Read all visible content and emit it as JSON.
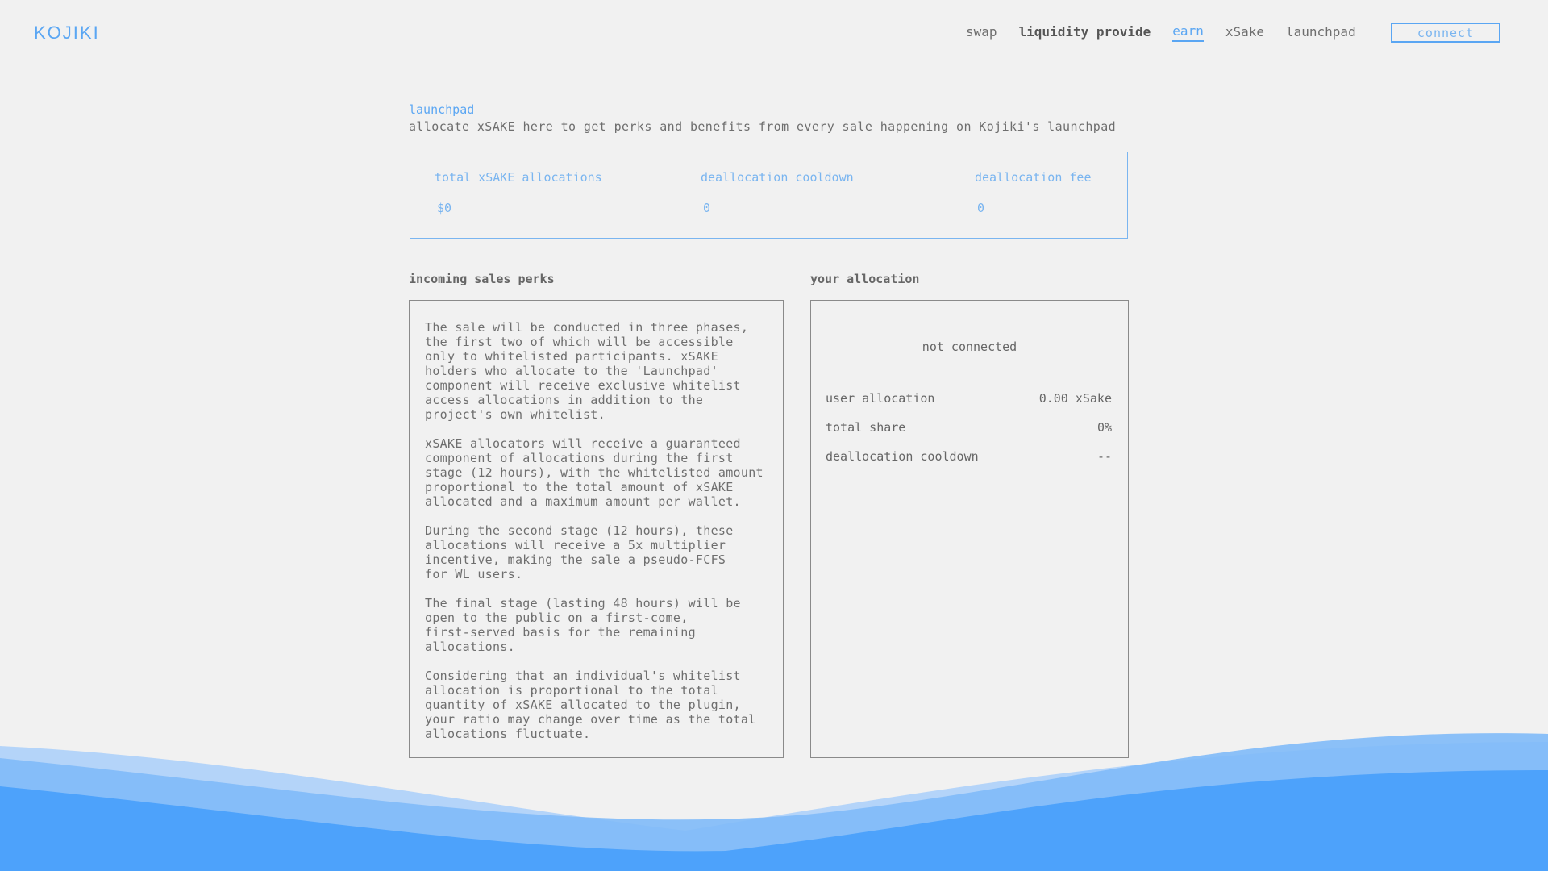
{
  "brand": {
    "logo": "KOJIKI"
  },
  "nav": {
    "items": [
      "swap",
      "liquidity provide",
      "earn",
      "xSake",
      "launchpad"
    ],
    "connect_label": "connect"
  },
  "intro": {
    "tag": "launchpad",
    "description": "allocate xSAKE here to get perks and benefits from every sale happening on Kojiki's launchpad"
  },
  "stats": [
    {
      "label": "total xSAKE allocations",
      "value": "$0"
    },
    {
      "label": "deallocation cooldown",
      "value": "0"
    },
    {
      "label": "deallocation fee",
      "value": "0"
    }
  ],
  "perks": {
    "title": "incoming sales perks",
    "paragraphs": [
      "The sale will be conducted in three phases,\nthe first two of which will be accessible\nonly to whitelisted participants. xSAKE\nholders who allocate to the 'Launchpad'\ncomponent will receive exclusive whitelist\naccess allocations in addition to the\nproject's own whitelist.",
      "xSAKE allocators will receive a guaranteed\ncomponent of allocations during the first\nstage (12 hours), with the whitelisted amount\nproportional to the total amount of xSAKE\nallocated and a maximum amount per wallet.",
      "During the second stage (12 hours), these\nallocations will receive a 5x multiplier\nincentive, making the sale a pseudo-FCFS\nfor WL users.",
      "The final stage (lasting 48 hours) will be\nopen to the public on a first-come,\nfirst-served basis for the remaining\nallocations.",
      "Considering that an individual's whitelist\nallocation is proportional to the total\nquantity of xSAKE allocated to the plugin,\nyour ratio may change over time as the total\nallocations fluctuate."
    ]
  },
  "allocation": {
    "title": "your allocation",
    "status": "not connected",
    "rows": [
      {
        "label": "user allocation",
        "value": "0.00 xSake"
      },
      {
        "label": "total share",
        "value": "0%"
      },
      {
        "label": "deallocation cooldown",
        "value": "--"
      }
    ]
  },
  "colors": {
    "accent": "#5aa6f3",
    "background": "#f1f1f1",
    "wave_light": "#a9cffa",
    "wave_mid": "#7fbaf8",
    "wave_dark": "#4da2fb"
  }
}
